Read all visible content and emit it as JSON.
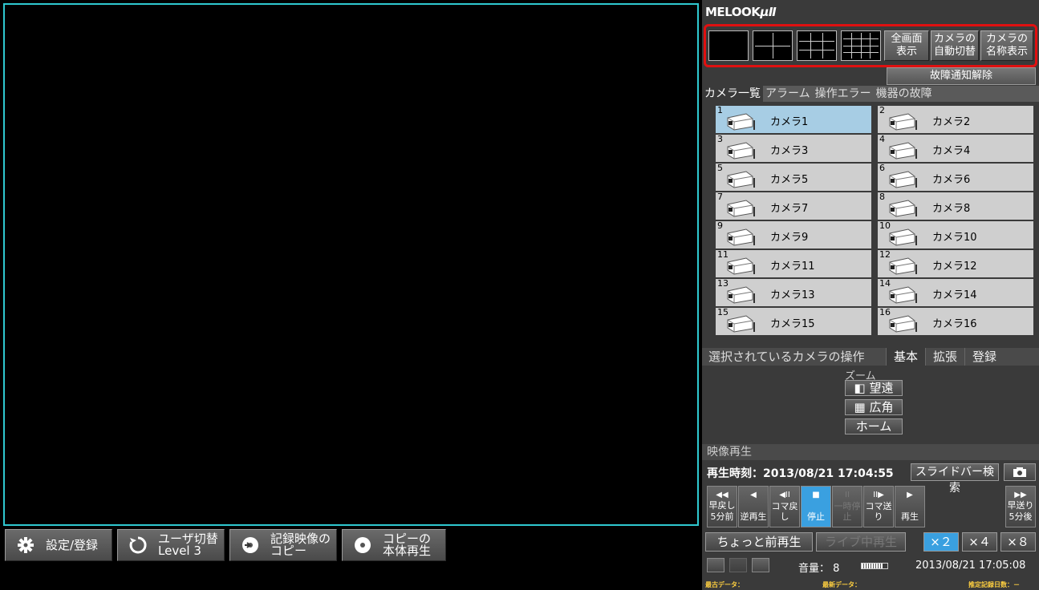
{
  "bottom_bar": {
    "settings": "設定/登録",
    "user_switch": "ユーザ切替\nLevel 3",
    "copy_record": "記録映像の\nコピー",
    "copy_play": "コピーの\n本体再生"
  },
  "panel": {
    "logo_main": "MELOOK",
    "logo_suffix": "μⅡ",
    "layout": {
      "fullscreen": "全画面\n表示",
      "auto_switch": "カメラの\n自動切替",
      "name_display": "カメラの\n名称表示"
    },
    "fault_clear": "故障通知解除",
    "tabs": [
      "カメラ一覧",
      "アラーム",
      "操作エラー",
      "機器の故障"
    ],
    "cameras": [
      {
        "num": "1",
        "name": "カメラ1"
      },
      {
        "num": "2",
        "name": "カメラ2"
      },
      {
        "num": "3",
        "name": "カメラ3"
      },
      {
        "num": "4",
        "name": "カメラ4"
      },
      {
        "num": "5",
        "name": "カメラ5"
      },
      {
        "num": "6",
        "name": "カメラ6"
      },
      {
        "num": "7",
        "name": "カメラ7"
      },
      {
        "num": "8",
        "name": "カメラ8"
      },
      {
        "num": "9",
        "name": "カメラ9"
      },
      {
        "num": "10",
        "name": "カメラ10"
      },
      {
        "num": "11",
        "name": "カメラ11"
      },
      {
        "num": "12",
        "name": "カメラ12"
      },
      {
        "num": "13",
        "name": "カメラ13"
      },
      {
        "num": "14",
        "name": "カメラ14"
      },
      {
        "num": "15",
        "name": "カメラ15"
      },
      {
        "num": "16",
        "name": "カメラ16"
      }
    ],
    "operation": {
      "title": "選択されているカメラの操作",
      "tabs": [
        "基本",
        "拡張",
        "登録"
      ],
      "zoom_label": "ズーム",
      "tele": "望遠",
      "wide": "広角",
      "home": "ホーム"
    },
    "playback": {
      "header": "映像再生",
      "time": "再生時刻：2013/08/21 17:04:55",
      "slider_search": "スライドバー検索",
      "controls": {
        "rewind": "早戻し",
        "rewind_5": "5分前",
        "reverse": "逆再生",
        "frame_back": "コマ戻し",
        "stop": "停止",
        "pause": "一時停止",
        "frame_fwd": "コマ送り",
        "play": "再生",
        "ffwd": "早送り",
        "ffwd_5": "5分後"
      },
      "quick_replay": "ちょっと前再生",
      "live_replay": "ライブ中再生",
      "speed_x2": "×２",
      "speed_x4": "×４",
      "speed_x8": "×８"
    },
    "volume_label": "音量： 8",
    "volume_level": 0.8,
    "clock": "2013/08/21 17:05:08",
    "footer": {
      "oldest": "最古データ：",
      "newest": "最新データ：",
      "est_days": "推定記録日数：－"
    }
  }
}
